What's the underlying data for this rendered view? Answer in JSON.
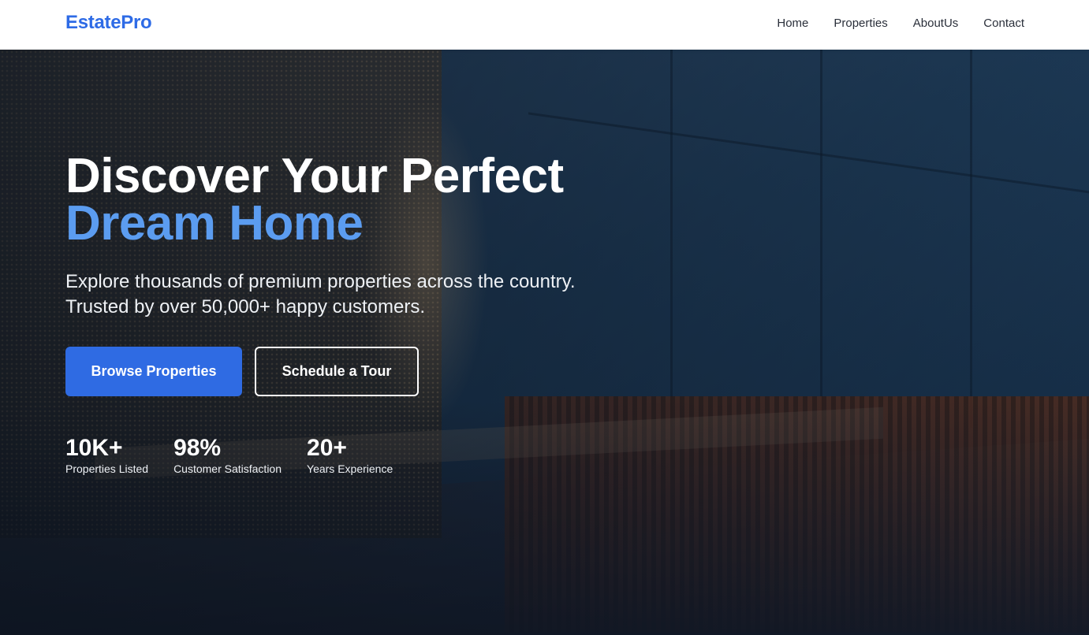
{
  "brand": {
    "name": "EstatePro",
    "color": "#2e6be6"
  },
  "nav": {
    "links": [
      {
        "label": "Home"
      },
      {
        "label": "Properties"
      },
      {
        "label": "AboutUs"
      },
      {
        "label": "Contact"
      }
    ]
  },
  "hero": {
    "title_line1": "Discover Your Perfect",
    "title_line2": "Dream Home",
    "subtitle": "Explore thousands of premium properties across the country. Trusted by over 50,000+ happy customers.",
    "primary_button": "Browse Properties",
    "secondary_button": "Schedule a Tour",
    "accent_color": "#5b9cf0",
    "button_color": "#2f6be3",
    "stats": [
      {
        "value": "10K+",
        "label": "Properties Listed"
      },
      {
        "value": "98%",
        "label": "Customer Satisfaction"
      },
      {
        "value": "20+",
        "label": "Years Experience"
      }
    ]
  }
}
